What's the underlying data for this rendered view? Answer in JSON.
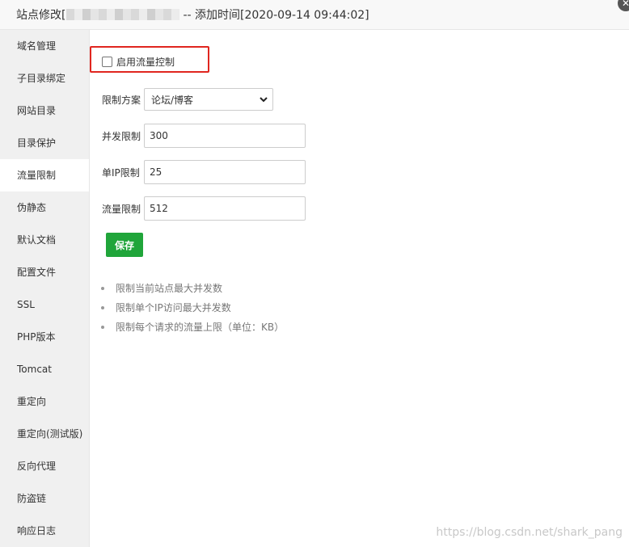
{
  "window": {
    "title_prefix": "站点修改[",
    "title_suffix": "-- 添加时间[2020-09-14 09:44:02]",
    "close_glyph": "✕"
  },
  "sidebar": {
    "items": [
      {
        "label": "域名管理"
      },
      {
        "label": "子目录绑定"
      },
      {
        "label": "网站目录"
      },
      {
        "label": "目录保护"
      },
      {
        "label": "流量限制"
      },
      {
        "label": "伪静态"
      },
      {
        "label": "默认文档"
      },
      {
        "label": "配置文件"
      },
      {
        "label": "SSL"
      },
      {
        "label": "PHP版本"
      },
      {
        "label": "Tomcat"
      },
      {
        "label": "重定向"
      },
      {
        "label": "重定向(测试版)"
      },
      {
        "label": "反向代理"
      },
      {
        "label": "防盗链"
      },
      {
        "label": "响应日志"
      }
    ],
    "active": "流量限制"
  },
  "form": {
    "enable_label": "启用流量控制",
    "enable_checked": false,
    "scheme_label": "限制方案",
    "scheme_value": "论坛/博客",
    "concurrency_label": "并发限制",
    "concurrency_value": "300",
    "per_ip_label": "单IP限制",
    "per_ip_value": "25",
    "rate_label": "流量限制",
    "rate_value": "512",
    "save_label": "保存"
  },
  "tips": [
    "限制当前站点最大并发数",
    "限制单个IP访问最大并发数",
    "限制每个请求的流量上限（单位：KB）"
  ],
  "watermark": "https://blog.csdn.net/shark_pang",
  "colors": {
    "accent_green": "#20a53a",
    "highlight_red": "#e0261f"
  }
}
